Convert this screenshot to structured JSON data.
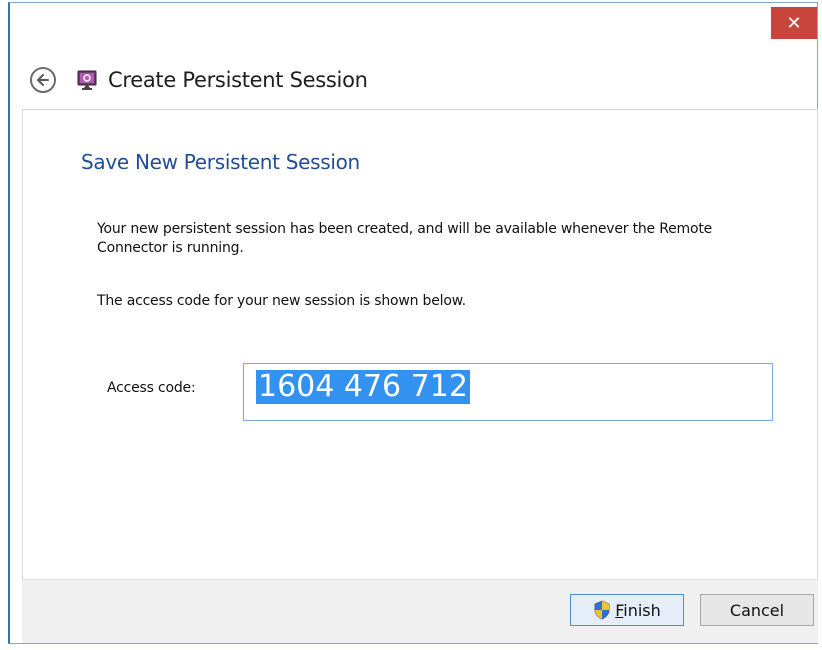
{
  "window": {
    "close_glyph": "✕",
    "title": "Create Persistent Session"
  },
  "header": {
    "back_icon": "back-arrow-icon",
    "app_icon": "remote-session-icon",
    "title": "Create Persistent Session"
  },
  "content": {
    "page_title": "Save New Persistent Session",
    "paragraph1": "Your new persistent session has been created, and will be available whenever the Remote Connector is running.",
    "paragraph2": "The access code for your new session is shown below.",
    "access_code_label": "Access code:",
    "access_code_value": "1604 476 712"
  },
  "footer": {
    "finish_label": "Finish",
    "cancel_label": "Cancel"
  },
  "colors": {
    "title_blue": "#1f4e96",
    "close_red": "#c7453a",
    "selection_blue": "#3391f0"
  }
}
